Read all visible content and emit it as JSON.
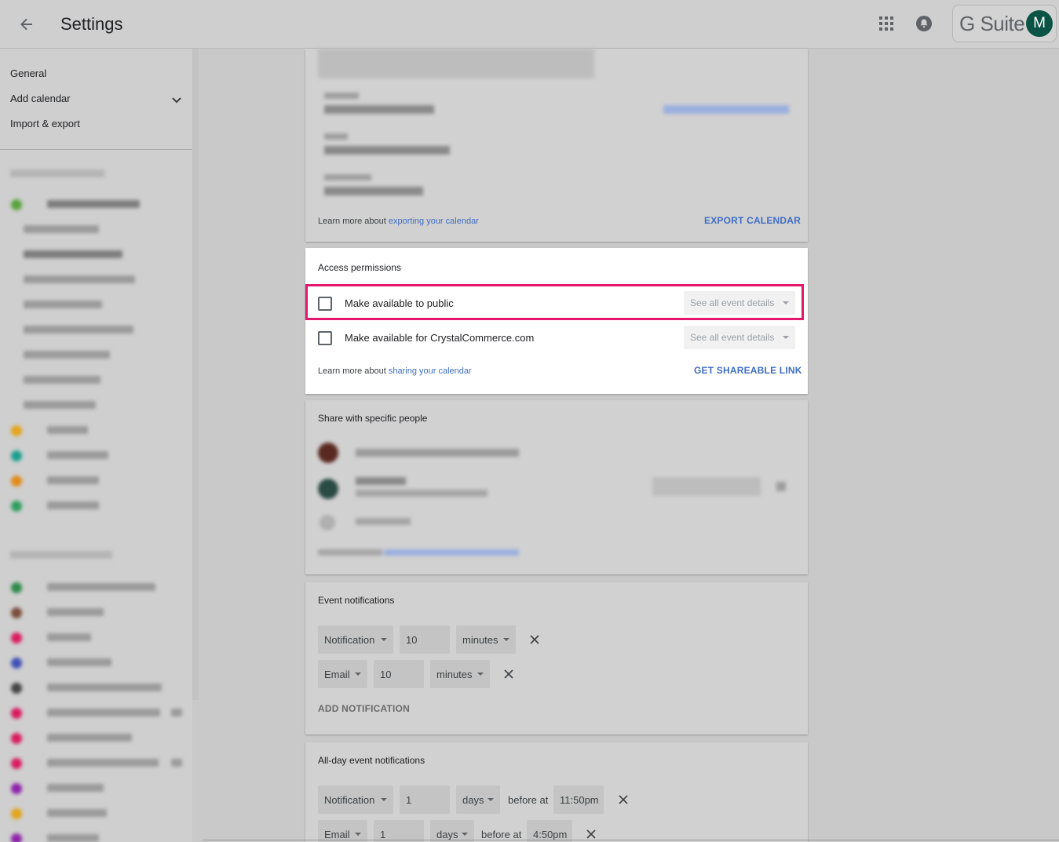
{
  "header": {
    "title": "Settings",
    "brand": "G Suite",
    "avatar_initial": "M"
  },
  "sidebar": {
    "nav": [
      "General",
      "Add calendar",
      "Import & export"
    ]
  },
  "colors": {
    "link": "#3f6ec4",
    "highlight": "#e3176b",
    "avatar": "#0b5345"
  },
  "export_card": {
    "learn_prefix": "Learn more about ",
    "learn_link": "exporting your calendar",
    "export_button": "EXPORT CALENDAR"
  },
  "access": {
    "title": "Access permissions",
    "public_label": "Make available to public",
    "public_select": "See all event details",
    "org_label": "Make available for CrystalCommerce.com",
    "org_select": "See all event details",
    "learn_prefix": "Learn more about ",
    "learn_link": "sharing your calendar",
    "shareable_button": "GET SHAREABLE LINK"
  },
  "share": {
    "title": "Share with specific people"
  },
  "event_notifications": {
    "title": "Event notifications",
    "rows": [
      {
        "type": "Notification",
        "amount": "10",
        "unit": "minutes"
      },
      {
        "type": "Email",
        "amount": "10",
        "unit": "minutes"
      }
    ],
    "add_button": "ADD NOTIFICATION"
  },
  "allday_notifications": {
    "title": "All-day event notifications",
    "rows": [
      {
        "type": "Notification",
        "amount": "1",
        "unit": "days",
        "before": "before at",
        "time": "11:50pm"
      },
      {
        "type": "Email",
        "amount": "1",
        "unit": "days",
        "before": "before at",
        "time": "4:50pm"
      }
    ]
  }
}
